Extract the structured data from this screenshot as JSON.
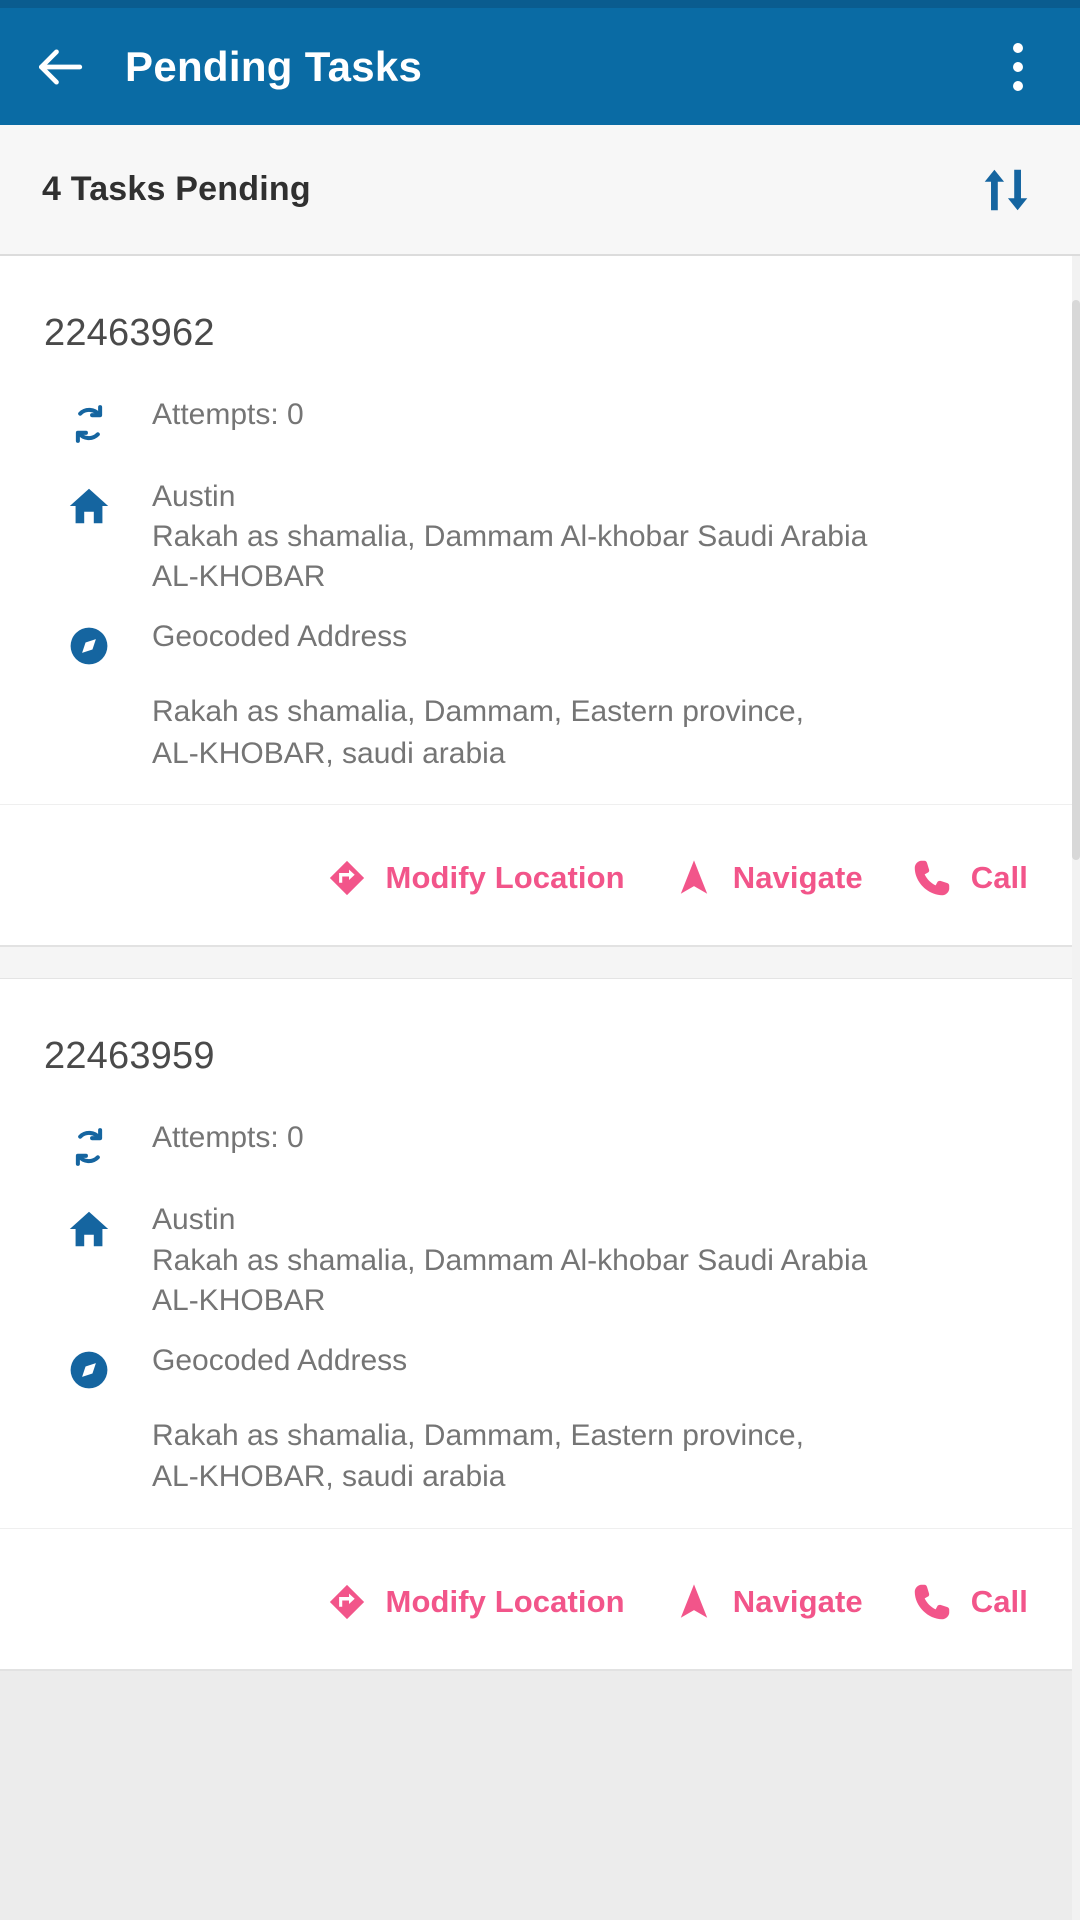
{
  "theme": {
    "primary_blue": "#0a6ba4",
    "status_blue": "#0a5c8f",
    "accent_pink": "#f2558a",
    "icon_blue": "#1565a0",
    "text_gray": "#757575",
    "id_gray": "#4a4a4a"
  },
  "appbar": {
    "back_icon": "arrow-left-icon",
    "title": "Pending Tasks",
    "overflow_icon": "more-vertical-icon"
  },
  "subheader": {
    "title": "4 Tasks Pending",
    "sort_icon": "sort-arrows-icon"
  },
  "actions_labels": {
    "modify_location": "Modify Location",
    "navigate": "Navigate",
    "call": "Call",
    "modify_location_icon": "modify-location-diamond-icon",
    "navigate_icon": "navigation-arrow-icon",
    "call_icon": "phone-icon"
  },
  "labels": {
    "attempts_icon": "sync-attempts-icon",
    "home_icon": "home-icon",
    "geocode_icon": "compass-icon",
    "geocoded_address": "Geocoded Address"
  },
  "tasks": [
    {
      "id": "22463962",
      "attempts": "Attempts: 0",
      "address": {
        "name": "Austin",
        "line1": "Rakah as shamalia, Dammam  Al-khobar Saudi Arabia",
        "line2": "AL-KHOBAR"
      },
      "geocoded": {
        "title": "Geocoded Address",
        "line1": "Rakah as shamalia, Dammam, Eastern province,",
        "line2": "AL-KHOBAR, saudi arabia"
      }
    },
    {
      "id": "22463959",
      "attempts": "Attempts: 0",
      "address": {
        "name": "Austin",
        "line1": "Rakah as shamalia, Dammam  Al-khobar Saudi Arabia",
        "line2": "AL-KHOBAR"
      },
      "geocoded": {
        "title": "Geocoded Address",
        "line1": "Rakah as shamalia, Dammam, Eastern province,",
        "line2": "AL-KHOBAR, saudi arabia"
      }
    }
  ]
}
